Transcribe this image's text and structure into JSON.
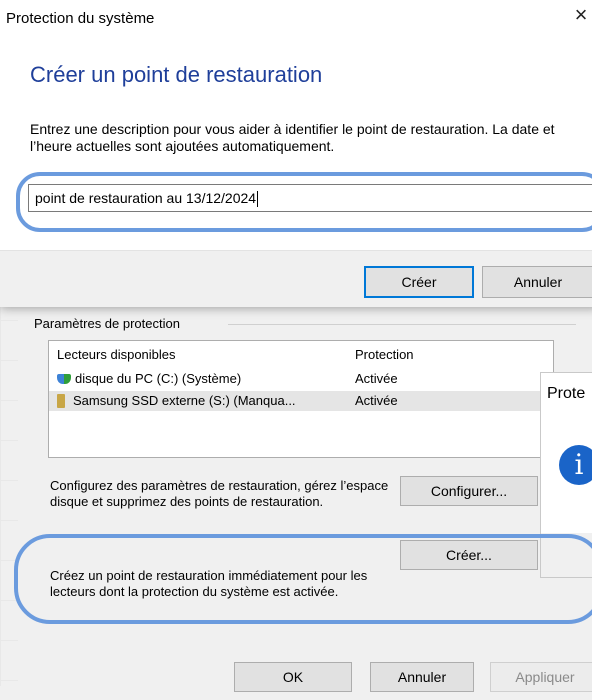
{
  "dialog": {
    "title": "Protection du système",
    "heading": "Créer un point de restauration",
    "instruction": "Entrez une description pour vous aider à identifier le point de restauration. La date et l’heure actuelles sont ajoutées automatiquement.",
    "input_value": "point de restauration au 13/12/2024",
    "create_label": "Créer",
    "cancel_label": "Annuler"
  },
  "protection": {
    "group_label": "Paramètres de protection",
    "columns": [
      "Lecteurs disponibles",
      "Protection"
    ],
    "drives": [
      {
        "name": "disque du PC (C:) (Système)",
        "status": "Activée",
        "icon": "system-drive-icon"
      },
      {
        "name": "Samsung SSD externe (S:) (Manqua...",
        "status": "Activée",
        "icon": "usb-drive-icon"
      }
    ],
    "configure_text": "Configurez des paramètres de restauration, gérez l’espace disque et supprimez des points de restauration.",
    "configure_label": "Configurer...",
    "create_text": "Créez un point de restauration immédiatement pour les lecteurs dont la protection du système est activée.",
    "create_label": "Créer..."
  },
  "footer": {
    "ok_label": "OK",
    "cancel_label": "Annuler",
    "apply_label": "Appliquer"
  },
  "info_dialog": {
    "title_fragment": "Prote",
    "icon": "i"
  },
  "colors": {
    "heading": "#1f3f9a",
    "highlight": "#6b9bde",
    "info_icon": "#1a64c8"
  }
}
